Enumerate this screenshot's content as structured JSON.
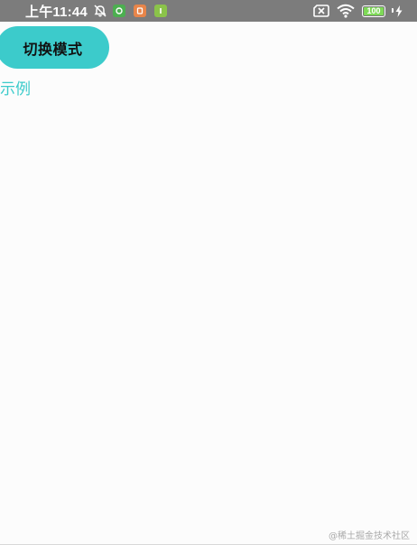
{
  "status_bar": {
    "time": "上午11:44",
    "battery_level": "100",
    "battery_fraction": 1.0,
    "icons": [
      "alarm-off-icon",
      "app-green-icon",
      "app-orange-icon",
      "app-lime-icon",
      "sim-off-icon",
      "wifi-icon",
      "battery-icon",
      "charging-icon"
    ],
    "colors": {
      "background": "#7c7c7c",
      "app_green": "#4caf50",
      "app_orange": "#e8854a",
      "app_lime": "#8bc34a",
      "battery_fill": "#7ed957"
    }
  },
  "main": {
    "mode_button_label": "切换模式",
    "example_label": "示例",
    "accent_color": "#3ccbcb"
  },
  "watermark": "@稀土掘金技术社区"
}
